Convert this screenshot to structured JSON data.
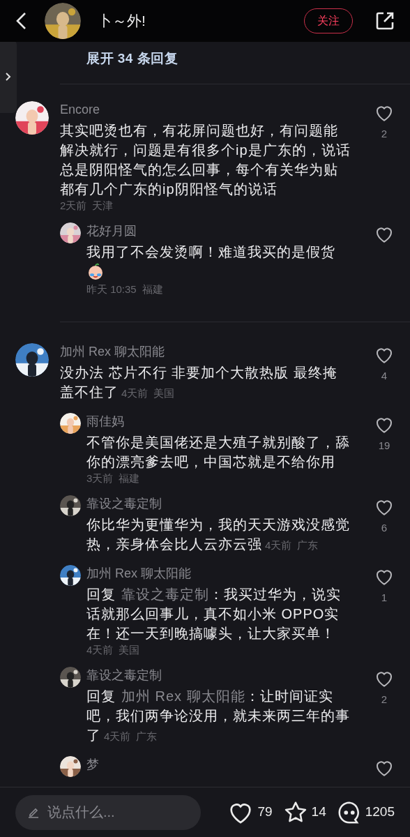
{
  "header": {
    "title": "卜～外!",
    "follow_button": "关注"
  },
  "expand_link": "展开 34 条回复",
  "comments": [
    {
      "name": "Encore",
      "text": "其实吧烫也有，有花屏问题也好，有问题能解决就行，问题是有很多个ip是广东的，说话总是阴阳怪气的怎么回事，每个有关华为贴都有几个广东的ip阴阳怪气的说话",
      "time": "2天前",
      "location": "天津",
      "likes": "2",
      "meta_inline": false,
      "replies": [
        {
          "name": "花好月圆",
          "text": "我用了不会发烫啊！难道我买的是假货",
          "emoji": true,
          "time": "昨天 10:35",
          "location": "福建",
          "meta_inline": false
        }
      ]
    },
    {
      "name": "加州 Rex 聊太阳能",
      "text": "没办法 芯片不行 非要加个大散热版 最终掩盖不住了",
      "time": "4天前",
      "location": "美国",
      "likes": "4",
      "meta_inline": true,
      "replies": [
        {
          "name": "雨佳妈",
          "text": "不管你是美国佬还是大殖子就别酸了，舔你的漂亮爹去吧，中国芯就是不给你用",
          "emoji": false,
          "time": "3天前",
          "location": "福建",
          "likes": "19",
          "meta_inline": false
        },
        {
          "name": "靠设之毒定制",
          "text": "你比华为更懂华为，我的天天游戏没感觉热，亲身体会比人云亦云强",
          "emoji": false,
          "time": "4天前",
          "location": "广东",
          "likes": "6",
          "meta_inline": true
        },
        {
          "name": "加州 Rex 聊太阳能",
          "reply_to": {
            "label": "回复",
            "target": "靠设之毒定制"
          },
          "text": "：我买过华为，说实话就那么回事儿，真不如小米 OPPO实在！还一天到晚搞噱头，让大家买单！",
          "emoji": false,
          "time": "4天前",
          "location": "美国",
          "likes": "1",
          "meta_inline": false
        },
        {
          "name": "靠设之毒定制",
          "reply_to": {
            "label": "回复",
            "target": "加州 Rex 聊太阳能"
          },
          "text": "：让时间证实吧，我们两争论没用，就未来两三年的事了",
          "emoji": false,
          "time": "4天前",
          "location": "广东",
          "likes": "2",
          "meta_inline": true
        },
        {
          "name": "梦",
          "emoji": false
        }
      ]
    }
  ],
  "bottom_bar": {
    "placeholder": "说点什么...",
    "likes": "79",
    "favorites": "14",
    "comments": "1205"
  }
}
